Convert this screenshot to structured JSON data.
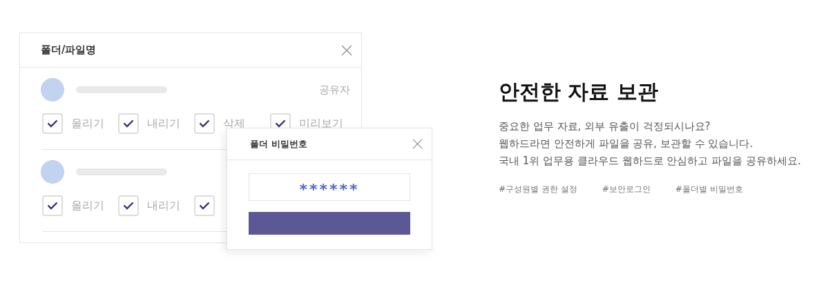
{
  "share_panel": {
    "title": "폴더/파일명",
    "members": [
      {
        "role": "공유자",
        "permissions": [
          {
            "label": "올리기",
            "checked": true
          },
          {
            "label": "내리기",
            "checked": true
          },
          {
            "label": "삭제",
            "checked": true
          },
          {
            "label": "미리보기",
            "checked": true
          }
        ]
      },
      {
        "permissions": [
          {
            "label": "올리기",
            "checked": true
          },
          {
            "label": "내리기",
            "checked": true
          },
          {
            "checked": true
          }
        ]
      }
    ]
  },
  "password_dialog": {
    "title": "폴더 비밀번호",
    "value": "******"
  },
  "feature": {
    "title": "안전한 자료 보관",
    "lines": [
      "중요한 업무 자료, 외부 유출이 걱정되시나요?",
      "웹하드라면 안전하게 파일을 공유, 보관할 수 있습니다.",
      "국내 1위 업무용 클라우드 웹하드로 안심하고 파일을 공유하세요."
    ],
    "tags": [
      "#구성원별 권한 설정",
      "#보안로그인",
      "#폴더별 비밀번호"
    ]
  }
}
